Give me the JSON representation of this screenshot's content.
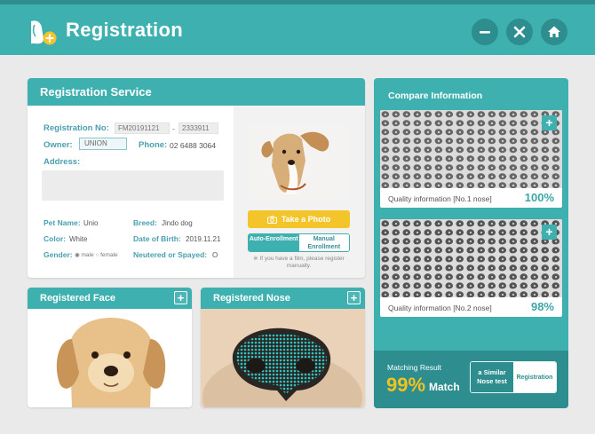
{
  "app": {
    "title": "Registration",
    "logo": "dog-add-icon"
  },
  "header_buttons": {
    "minimize": "minimize-icon",
    "close": "close-icon",
    "home": "home-icon"
  },
  "colors": {
    "teal": "#3fb0b0",
    "teal_dark": "#2d8d8f",
    "yellow": "#f3c52b",
    "label": "#4a9fb0"
  },
  "registration": {
    "title": "Registration Service",
    "reg_no_label": "Registration No:",
    "reg_no_1": "FM20191121",
    "reg_no_sep": "-",
    "reg_no_2": "2333911",
    "owner_label": "Owner:",
    "owner_value": "UNION",
    "phone_label": "Phone:",
    "phone_value": "02 6488 3064",
    "address_label": "Address:",
    "pet_name_label": "Pet Name:",
    "pet_name_value": "Unio",
    "breed_label": "Breed:",
    "breed_value": "Jindo dog",
    "color_label": "Color:",
    "color_value": "White",
    "dob_label": "Date of Birth:",
    "dob_value": "2019.11.21",
    "gender_label": "Gender:",
    "gender_male": "male",
    "gender_female": "female",
    "neutered_label": "Neutered or Spayed:",
    "neutered_value": "O",
    "take_photo": "Take a Photo",
    "auto_enroll": "Auto-Enrollment",
    "manual_enroll": "Manual Enrollment",
    "note": "※ If you have a film, please register manually."
  },
  "face": {
    "title": "Registered Face"
  },
  "nose": {
    "title": "Registered Nose"
  },
  "compare": {
    "title": "Compare Information",
    "items": [
      {
        "label": "Quality information [No.1 nose]",
        "value": "100%"
      },
      {
        "label": "Quality information [No.2 nose]",
        "value": "98%"
      }
    ],
    "matching_label": "Matching Result",
    "matching_value": "99%",
    "matching_suffix": "Match",
    "similar_btn": "a Similar Nose test",
    "registration_btn": "Registration"
  }
}
